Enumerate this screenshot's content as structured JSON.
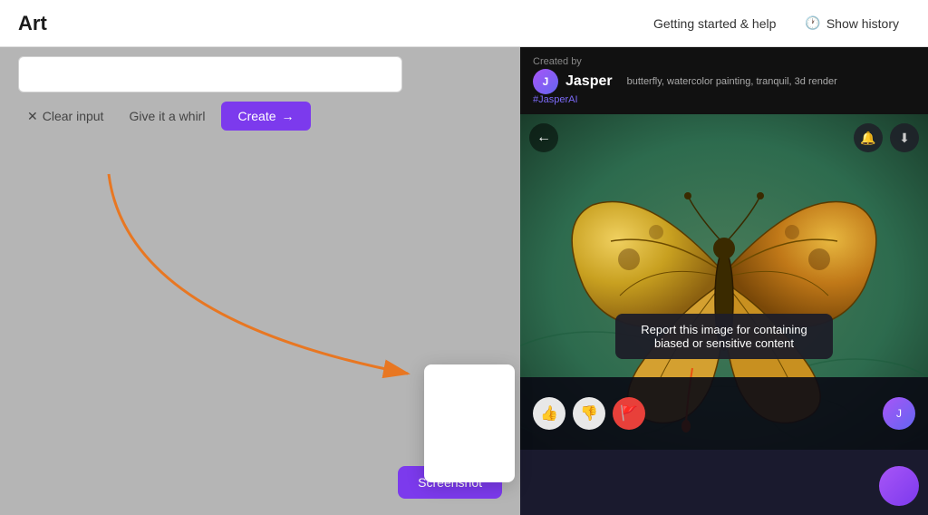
{
  "header": {
    "logo": "Art",
    "getting_started_label": "Getting started & help",
    "show_history_label": "Show history",
    "clock_icon": "🕐"
  },
  "toolbar": {
    "clear_label": "Clear input",
    "give_whirl_label": "Give it a whirl",
    "create_label": "Create",
    "create_arrow": "→",
    "clear_icon": "✕"
  },
  "panel": {
    "created_by": "Created by",
    "username": "Jasper",
    "hashtag": "#JasperAI",
    "tags": "butterfly, watercolor painting, tranquil, 3d render",
    "tooltip": "Report this image for containing biased or sensitive content"
  },
  "screenshot_btn": "Screenshot"
}
